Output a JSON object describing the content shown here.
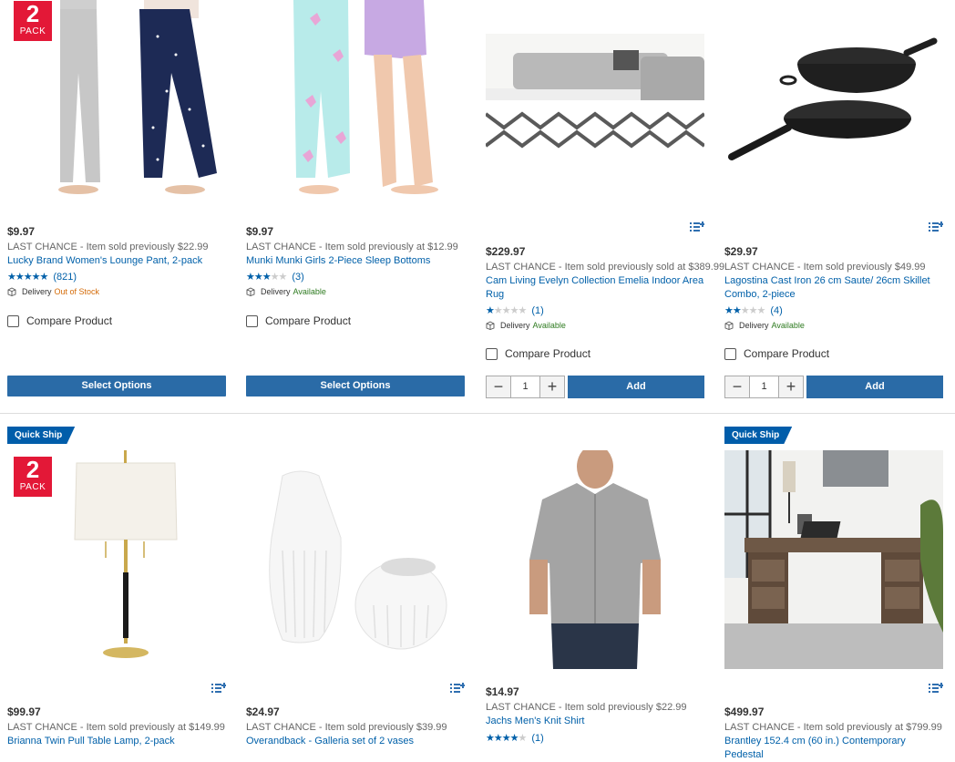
{
  "badges": {
    "pack_number": "2",
    "pack_text": "PACK",
    "quick_ship": "Quick Ship"
  },
  "labels": {
    "compare": "Compare Product",
    "delivery": "Delivery",
    "select_options": "Select Options",
    "add": "Add",
    "minus": "−",
    "plus": "+"
  },
  "row1": [
    {
      "price": "$9.97",
      "last_chance": "LAST CHANCE - Item sold previously $22.99",
      "title": "Lucky Brand Women's Lounge Pant, 2-pack",
      "stars": "★★★★★",
      "stars_off": "",
      "reviews": "(821)",
      "delivery_status": "Out of Stock",
      "button": "Select Options"
    },
    {
      "price": "$9.97",
      "last_chance": "LAST CHANCE - Item sold previously at $12.99",
      "title": "Munki Munki Girls 2-Piece Sleep Bottoms",
      "stars": "★★★",
      "stars_off": "★★",
      "reviews": "(3)",
      "delivery_status": "Available",
      "button": "Select Options"
    },
    {
      "price": "$229.97",
      "last_chance": "LAST CHANCE - Item sold previously sold at $389.99",
      "title": "Cam Living Evelyn Collection Emelia Indoor Area Rug",
      "stars": "★",
      "stars_off": "★★★★",
      "reviews": "(1)",
      "delivery_status": "Available",
      "qty": "1"
    },
    {
      "price": "$29.97",
      "last_chance": "LAST CHANCE - Item sold previously $49.99",
      "title": "Lagostina Cast Iron 26 cm Saute/ 26cm Skillet Combo, 2-piece",
      "stars": "★★",
      "stars_off": "★★★",
      "reviews": "(4)",
      "delivery_status": "Available",
      "qty": "1"
    }
  ],
  "row2": [
    {
      "price": "$99.97",
      "last_chance": "LAST CHANCE - Item sold previously at $149.99",
      "title": "Brianna Twin Pull Table Lamp, 2-pack"
    },
    {
      "price": "$24.97",
      "last_chance": "LAST CHANCE - Item sold previously $39.99",
      "title": "Overandback - Galleria set of 2 vases"
    },
    {
      "price": "$14.97",
      "last_chance": "LAST CHANCE - Item sold previously $22.99",
      "title": "Jachs Men's Knit Shirt",
      "stars": "★★★★",
      "stars_off": "★",
      "reviews": "(1)"
    },
    {
      "price": "$499.97",
      "last_chance": "LAST CHANCE - Item sold previously at $799.99",
      "title": "Brantley 152.4 cm (60 in.) Contemporary Pedestal"
    }
  ]
}
